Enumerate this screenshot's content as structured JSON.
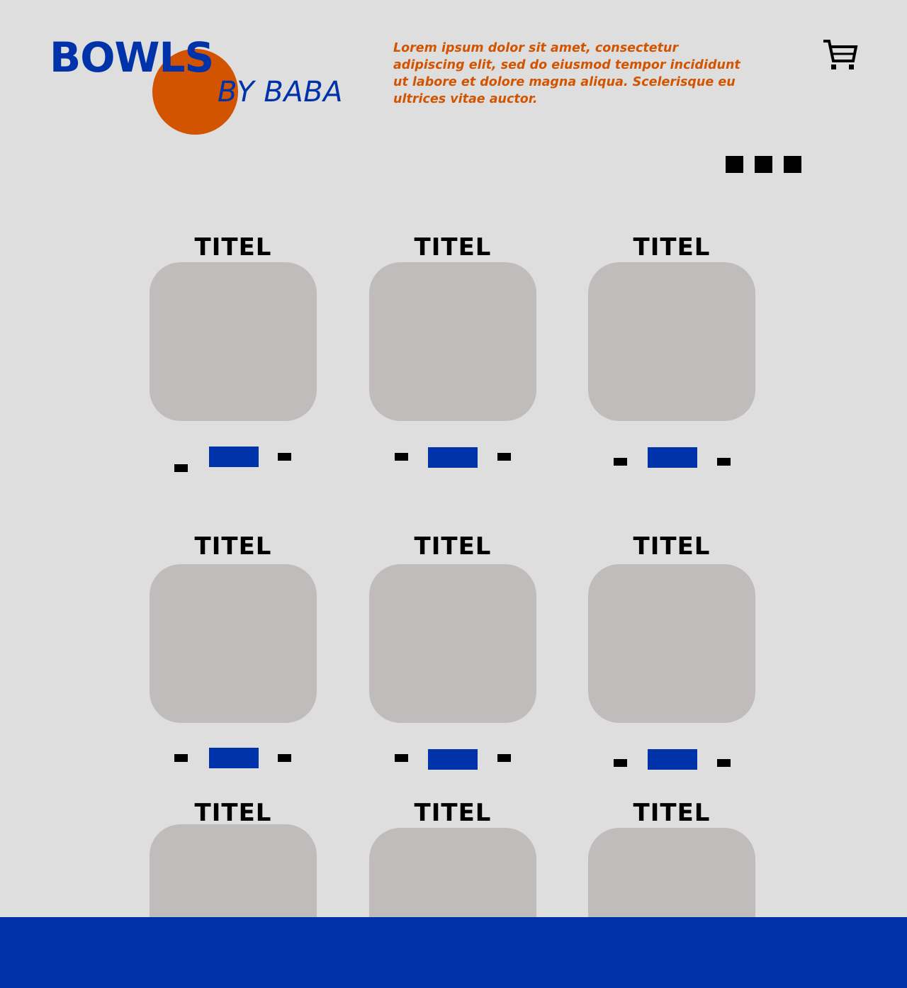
{
  "brand": {
    "name": "BOWLS",
    "byline": "BY BABA",
    "accent_color": "#d35400",
    "primary_color": "#0033aa"
  },
  "intro_text": "Lorem ipsum dolor sit amet, consectetur adipiscing elit, sed do eiusmod tempor incididunt ut labore et dolore magna aliqua. Scelerisque eu ultrices vitae auctor.",
  "header": {
    "cart_icon": "shopping-cart-icon",
    "menu_icon": "menu-icon"
  },
  "products": [
    {
      "title": "TITEL"
    },
    {
      "title": "TITEL"
    },
    {
      "title": "TITEL"
    },
    {
      "title": "TITEL"
    },
    {
      "title": "TITEL"
    },
    {
      "title": "TITEL"
    },
    {
      "title": "TITEL"
    },
    {
      "title": "TITEL"
    },
    {
      "title": "TITEL"
    }
  ]
}
